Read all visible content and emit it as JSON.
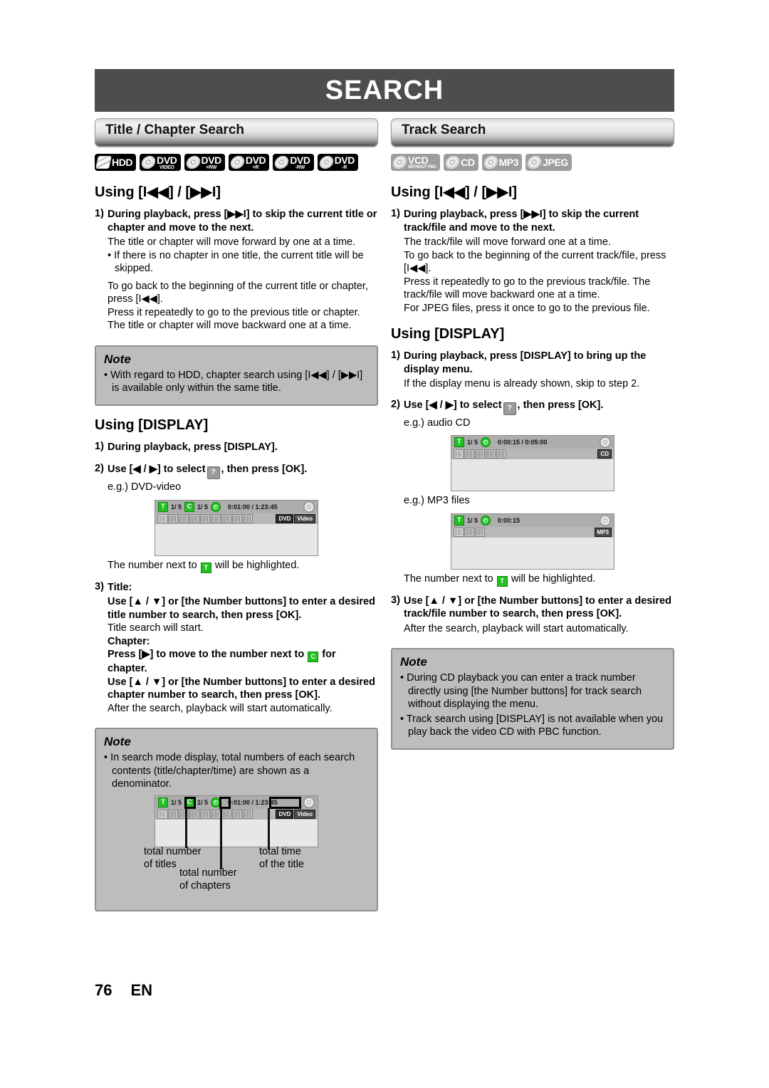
{
  "banner": {
    "title": "SEARCH"
  },
  "footer": {
    "page_number": "76",
    "language": "EN"
  },
  "left": {
    "section_title": "Title / Chapter Search",
    "badges": [
      {
        "name": "HDD",
        "line1": "HDD",
        "line2": "",
        "style": "dark"
      },
      {
        "name": "DVD Video",
        "line1": "DVD",
        "line2": "VIDEO",
        "style": "dark"
      },
      {
        "name": "DVD +RW",
        "line1": "DVD",
        "line2": "+RW",
        "style": "dark"
      },
      {
        "name": "DVD +R",
        "line1": "DVD",
        "line2": "+R",
        "style": "dark"
      },
      {
        "name": "DVD -RW",
        "line1": "DVD",
        "line2": "-RW",
        "style": "dark"
      },
      {
        "name": "DVD -R",
        "line1": "DVD",
        "line2": "-R",
        "style": "dark"
      }
    ],
    "using_skip_heading": "Using [I◀◀] / [▶▶I]",
    "step1_num": "1)",
    "step1_text": "During playback, press [▶▶I] to skip the current title or chapter and move to the next.",
    "step1_p1": "The title or chapter will move forward by one at a time.",
    "step1_bullet": "• If there is no chapter in one title, the current title will be skipped.",
    "step1_p2": "To go back to the beginning of the current title or chapter, press [I◀◀].",
    "step1_p3": "Press it repeatedly to go to the previous title or chapter. The title or chapter will move backward one at a time.",
    "note1_title": "Note",
    "note1_items": [
      "With regard to HDD, chapter search using [I◀◀] / [▶▶I] is available only within the same title."
    ],
    "using_display_heading": "Using [DISPLAY]",
    "d_step1_num": "1)",
    "d_step1_text": "During playback, press [DISPLAY].",
    "d_step2_num": "2)",
    "d_step2_text_a": "Use [◀ / ▶] to select",
    "d_step2_text_b": ", then press [OK].",
    "d_step2_eg": "e.g.) DVD-video",
    "osd_dvd": {
      "title_tag": "T",
      "title_num": "1/  5",
      "chapter_tag": "C",
      "chapter_num": "1/  5",
      "time_tag": "◴",
      "time": "0:01:00 / 1:23:45",
      "label1": "DVD",
      "label2": "Video"
    },
    "highlight_sentence_a": "The number next to",
    "highlight_sentence_b": "will be highlighted.",
    "highlight_tag": "T",
    "step3_num": "3)",
    "step3_title_label": "Title:",
    "step3_title_instr": "Use [▲ / ▼] or [the Number buttons] to enter a desired title number to search, then press [OK].",
    "step3_title_note": "Title search will start.",
    "step3_chapter_label": "Chapter:",
    "step3_chapter_instr_a": "Press [▶] to move to the number next to",
    "step3_chapter_instr_b": "for chapter.",
    "step3_chapter_tag": "C",
    "step3_chapter_instr2": "Use [▲ / ▼] or [the Number buttons] to enter a desired chapter number to search, then press [OK].",
    "step3_after": "After the search, playback will start automatically.",
    "note2_title": "Note",
    "note2_items": [
      "In search mode display, total numbers of each search contents (title/chapter/time) are shown as a denominator."
    ],
    "callout": {
      "total_titles": "total number\nof titles",
      "total_titles_l1": "total number",
      "total_titles_l2": "of titles",
      "total_chapters_l1": "total number",
      "total_chapters_l2": "of chapters",
      "total_time_l1": "total time",
      "total_time_l2": "of the title"
    }
  },
  "right": {
    "section_title": "Track Search",
    "badges": [
      {
        "name": "VCD without PBC",
        "line1": "VCD",
        "line2": "WITHOUT PBC",
        "style": "grey"
      },
      {
        "name": "CD",
        "line1": "CD",
        "line2": "",
        "style": "grey"
      },
      {
        "name": "MP3",
        "line1": "MP3",
        "line2": "",
        "style": "grey"
      },
      {
        "name": "JPEG",
        "line1": "JPEG",
        "line2": "",
        "style": "grey"
      }
    ],
    "using_skip_heading": "Using [I◀◀] / [▶▶I]",
    "step1_num": "1)",
    "step1_text": "During playback, press [▶▶I] to skip the current track/file and move to the next.",
    "step1_p1": "The track/file will move forward one at a time.",
    "step1_p2": "To go back to the beginning of the current track/file, press [I◀◀].",
    "step1_p3": "Press it repeatedly to go to the previous track/file. The track/file will move backward one at a time.",
    "step1_p4": "For JPEG files, press it once to go to the previous file.",
    "using_display_heading": "Using [DISPLAY]",
    "d_step1_num": "1)",
    "d_step1_text": "During playback, press [DISPLAY] to bring up the display menu.",
    "d_step1_p": "If the display menu is already shown, skip to step 2.",
    "d_step2_num": "2)",
    "d_step2_text_a": "Use [◀ / ▶] to select",
    "d_step2_text_b": ", then press [OK].",
    "d_step2_eg_cd": "e.g.) audio CD",
    "d_step2_eg_mp3": "e.g.) MP3 files",
    "osd_cd": {
      "title_tag": "T",
      "title_num": "1/  5",
      "time_tag": "◴",
      "time": "0:00:15 / 0:05:00",
      "label1": "CD"
    },
    "osd_mp3": {
      "title_tag": "T",
      "title_num": "1/  5",
      "time_tag": "◴",
      "time": "0:00:15",
      "label1": "MP3"
    },
    "highlight_sentence_a": "The number next to",
    "highlight_sentence_b": "will be highlighted.",
    "highlight_tag": "T",
    "step3_num": "3)",
    "step3_text": "Use [▲ / ▼] or [the Number buttons] to enter a desired track/file number to search, then press [OK].",
    "step3_after": "After the search, playback will start automatically.",
    "note_title": "Note",
    "note_items": [
      "During CD playback you can enter a track number directly using [the Number buttons] for track search without displaying the menu.",
      "Track search using [DISPLAY] is not available when you play back the video CD with PBC function."
    ]
  },
  "colors": {
    "banner_bg": "#4d4d4d",
    "note_bg": "#bdbdbd",
    "note_border": "#8f8f8f",
    "osd_green": "#22c022",
    "osd_bar": "#adadad"
  }
}
